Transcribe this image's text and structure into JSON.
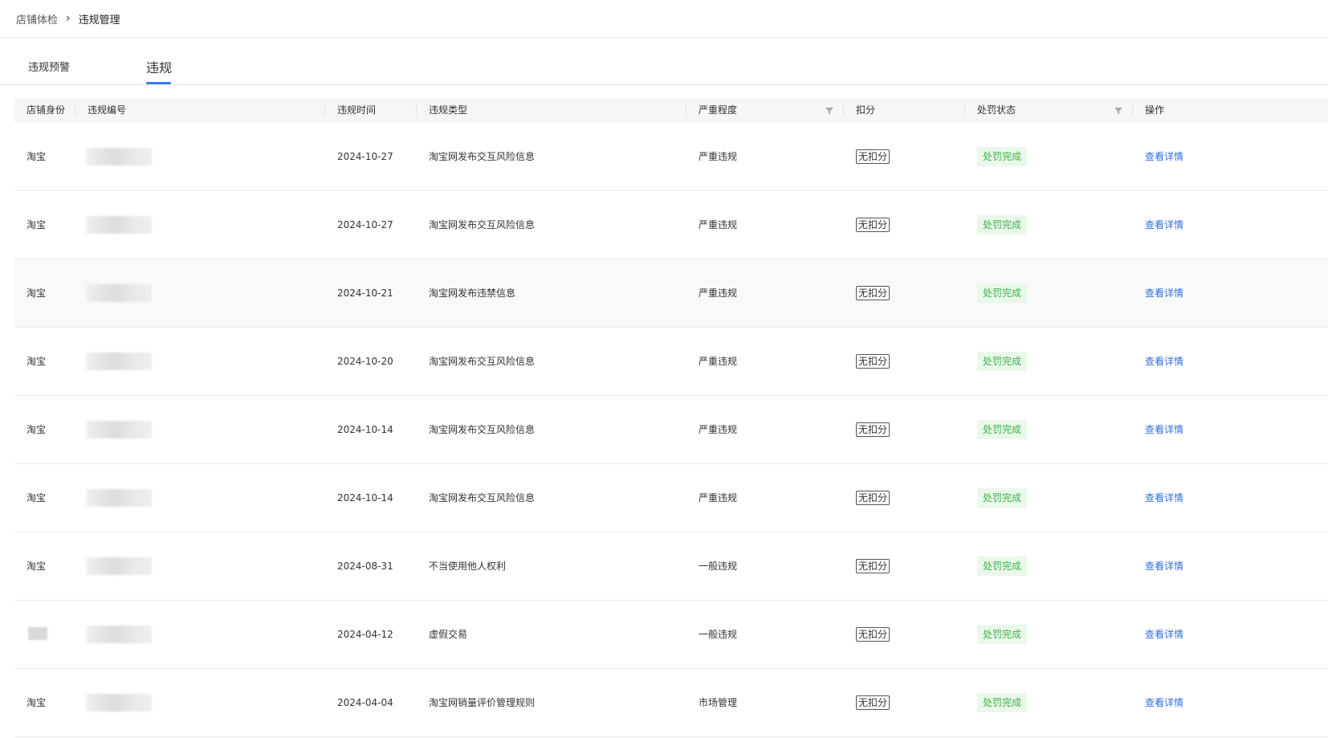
{
  "breadcrumb": {
    "parent": "店铺体检",
    "separator": "›",
    "current": "违规管理"
  },
  "tabs": [
    {
      "label": "违规预警",
      "active": false
    },
    {
      "label": "违规",
      "active": true
    }
  ],
  "table": {
    "columns": [
      "店铺身份",
      "违规编号",
      "违规时间",
      "违规类型",
      "严重程度",
      "扣分",
      "处罚状态",
      "操作"
    ],
    "rows": [
      {
        "shop": "淘宝",
        "time": "2024-10-27",
        "type": "淘宝网发布交互风险信息",
        "severity": "严重违规",
        "deduct": "无扣分",
        "status": "处罚完成",
        "action": "查看详情"
      },
      {
        "shop": "淘宝",
        "time": "2024-10-27",
        "type": "淘宝网发布交互风险信息",
        "severity": "严重违规",
        "deduct": "无扣分",
        "status": "处罚完成",
        "action": "查看详情"
      },
      {
        "shop": "淘宝",
        "time": "2024-10-21",
        "type": "淘宝网发布违禁信息",
        "severity": "严重违规",
        "deduct": "无扣分",
        "status": "处罚完成",
        "action": "查看详情"
      },
      {
        "shop": "淘宝",
        "time": "2024-10-20",
        "type": "淘宝网发布交互风险信息",
        "severity": "严重违规",
        "deduct": "无扣分",
        "status": "处罚完成",
        "action": "查看详情"
      },
      {
        "shop": "淘宝",
        "time": "2024-10-14",
        "type": "淘宝网发布交互风险信息",
        "severity": "严重违规",
        "deduct": "无扣分",
        "status": "处罚完成",
        "action": "查看详情"
      },
      {
        "shop": "淘宝",
        "time": "2024-10-14",
        "type": "淘宝网发布交互风险信息",
        "severity": "严重违规",
        "deduct": "无扣分",
        "status": "处罚完成",
        "action": "查看详情"
      },
      {
        "shop": "淘宝",
        "time": "2024-08-31",
        "type": "不当使用他人权利",
        "severity": "一般违规",
        "deduct": "无扣分",
        "status": "处罚完成",
        "action": "查看详情"
      },
      {
        "shop": "",
        "time": "2024-04-12",
        "type": "虚假交易",
        "severity": "一般违规",
        "deduct": "无扣分",
        "status": "处罚完成",
        "action": "查看详情"
      },
      {
        "shop": "淘宝",
        "time": "2024-04-04",
        "type": "淘宝网销量评价管理规则",
        "severity": "市场管理",
        "deduct": "无扣分",
        "status": "处罚完成",
        "action": "查看详情"
      }
    ]
  },
  "colors": {
    "accent": "#3d7bf5",
    "link": "#2f6fe0",
    "status_bg": "#e9f8ea",
    "status_text": "#3fb24a"
  }
}
